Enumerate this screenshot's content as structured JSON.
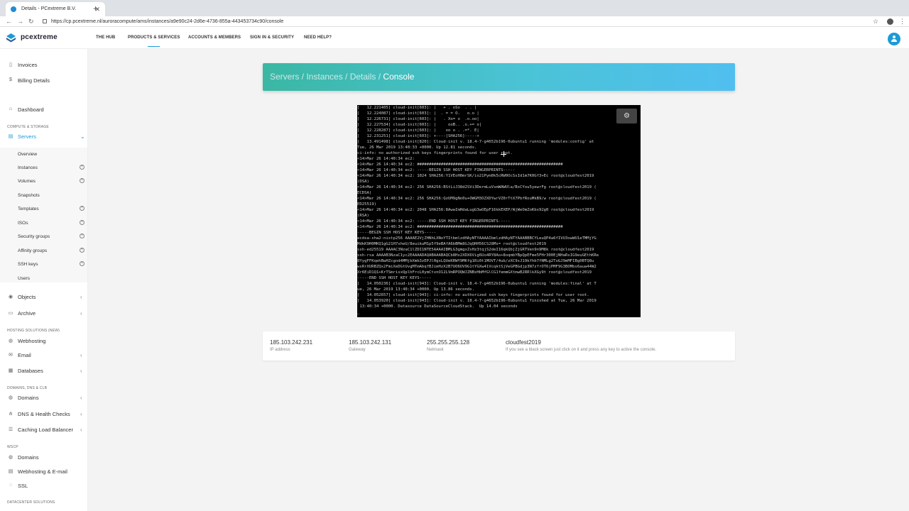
{
  "browser": {
    "tab_title": "Details - PCextreme B.V.",
    "url": "https://cp.pcextreme.nl/auroracompute/ams/instances/a9e90c24-2d6e-4736-855a-443453734c90/console"
  },
  "brand": {
    "name": "pcextreme",
    "accent": "#1d9ad6"
  },
  "topnav": [
    {
      "label": "THE HUB"
    },
    {
      "label": "PRODUCTS & SERVICES"
    },
    {
      "label": "ACCOUNTS & MEMBERS"
    },
    {
      "label": "SIGN IN & SECURITY"
    },
    {
      "label": "NEED HELP?"
    }
  ],
  "sidebar": {
    "top": [
      {
        "label": "Invoices",
        "icon": "document-icon"
      },
      {
        "label": "Billing Details",
        "icon": "dollar-icon"
      },
      {
        "label": "Dashboard",
        "icon": "home-icon"
      }
    ],
    "sections": {
      "compute": "COMPUTE & STORAGE",
      "hosting": "HOSTING SOLUTIONS (NEW)",
      "domains": "DOMAINS, DNS & CLB",
      "wscp": "WSCP",
      "datacenter": "DATACENTER SOLUTIONS"
    },
    "servers": "Servers",
    "server_subitems": [
      {
        "label": "Overview"
      },
      {
        "label": "Instances"
      },
      {
        "label": "Volumes"
      },
      {
        "label": "Snapshots"
      },
      {
        "label": "Templates"
      },
      {
        "label": "ISOs"
      },
      {
        "label": "Security groups"
      },
      {
        "label": "Affinity groups"
      },
      {
        "label": "SSH keys"
      },
      {
        "label": "Users"
      }
    ],
    "compute_more": [
      {
        "label": "Objects"
      },
      {
        "label": "Archive"
      }
    ],
    "hosting_items": [
      {
        "label": "Webhosting"
      },
      {
        "label": "Email"
      },
      {
        "label": "Databases"
      }
    ],
    "domain_items": [
      {
        "label": "Domains"
      },
      {
        "label": "DNS & Health Checks"
      },
      {
        "label": "Caching Load Balancer"
      }
    ],
    "wscp_items": [
      {
        "label": "Domains"
      },
      {
        "label": "Webhosting & E-mail"
      },
      {
        "label": "SSL"
      }
    ]
  },
  "breadcrumb": {
    "trail": "Servers / Instances / Details / ",
    "current": "Console"
  },
  "console": {
    "lines": [
      "[   12.221405] cloud-init[603]: |   + . oSo  . . |",
      "[   12.224087] cloud-init[603]: |  . = = O.   o.o |",
      "[   12.226731] cloud-init[603]: |   . Xo= o  .o.oo|",
      "[   12.227534] cloud-init[603]: |     ooB.. .o.+= o|",
      "[   12.228287] cloud-init[603]: |    oo o . .=*. E|",
      "[   12.231251] cloud-init[603]: +----[SHA256]-----+",
      "[   13.491498] cloud-init[820]: Cloud-init v. 18.4-7-g4652b196-0ubuntu1 running 'modules:config' at",
      "Tue, 26 Mar 2019 13:40:33 +0000. Up 12.81 seconds.",
      "ci-info: no authorized ssh keys fingerprints found for user root.",
      "<14>Mar 26 14:40:34 ec2:",
      "<14>Mar 26 14:40:34 ec2: #############################################################",
      "<14>Mar 26 14:40:34 ec2: -----BEGIN SSH HOST KEY FINGERPRINTS-----",
      "<14>Mar 26 14:40:34 ec2: 1024 SHA256:Y1VEoH0mrSK/io21Pym0k5cRW0OcSsId1m7K0Gf3+Ec root@cloudfest2019",
      "(DSA)",
      "<14>Mar 26 14:40:34 ec2: 256 SHA256:BStLiJ38d2SVi3DermLuVsmWAWUla/BxCYou5yewrFg root@cloudfest2019 (",
      "ECDSA)",
      "<14>Mar 26 14:40:34 ec2: 256 SHA256:QzUM9gNo0u+OWGM3OZXDYwrVZ0rTtX7PbfRouMkB9/w root@cloudfest2019 (",
      "ED25519)",
      "<14>Mar 26 14:40:34 ec2: 2048 SHA256:8AwwImHdaLugG3wOEpF16kkEXEP/WjWeOmZoKbx92g0 root@cloudfest2019",
      "(RSA)",
      "<14>Mar 26 14:40:34 ec2: -----END SSH HOST KEY FINGERPRINTS-----",
      "<14>Mar 26 14:40:34 ec2: #############################################################",
      "-----BEGIN SSH HOST KEY KEYS-----",
      "ecdsa-sha2-nistp256 AAAAE2VjZHNhLXNoYTItbmlzdHAyNTYAAAAIbmlzdHAyNTYAAABBBCYLeuQP4a6fIVU3owWU1eTMMjYG",
      "MdkK9H0MKQ1gG21H7xheU/8euikuM1p5f9eBAfA6bBMm8GJqQHH56CS28Ms= root@cloudfest2019",
      "ssh-ed25519 AAAAC3NzaC1lZDI1NTE5AAAAIBMLG3gmgxZsHz3tqjS2deI16qkQbjZjGRTVen9n9M8k root@cloudfest2019",
      "ssh-rsa AAAAB3NzaC1yc2EAAAADAQABAAABAQCb8Hx2XDX6Vig6Uo4RY8Ao+8oqmbYBpQpEFme5FHr300EjNHaRsIG9euGEthKRe",
      "8YygFFKqehBwHZcgnd4MMjbXmb3zEPJlHgxLQUeKRWY9MKfg1Ri0t1MOVT/4ub/zXC9sJ19kfhb7fNMLg2ToGJ9mMFIBg0BTQ8u",
      "wsRrXURBZQx2FmiXeDGtUvgMTmAbqfBJimHzX2B7UO6UV9G1tYGXw41VcqktSjVeGPBGdjp3N7zfrOT6jPMF9G3BOMbs6aua44W2",
      "Xr6EiD1Q1+KrTSmrisxQplhFrcL0ymCtvnO12LVmRPOQWJZNBxHbMfGlCG1femmGXtmwB2RRlkXGy9t root@cloudfest2019",
      "-----END SSH HOST KEY KEYS-----",
      "[   14.050236] cloud-init[943]: Cloud-init v. 18.4-7-g4652b196-0ubuntu1 running 'modules:final' at T",
      "ue, 26 Mar 2019 13:40:34 +0000. Up 13.86 seconds.",
      "[   14.052657] cloud-init[943]: ci-info: no authorized ssh keys fingerprints found for user root.",
      "[   14.053920] cloud-init[943]: Cloud-init v. 18.4-7-g4652b196-0ubuntu1 finished at Tue, 26 Mar 2019",
      " 13:40:34 +0000. Datasource DataSourceCloudStack.  Up 14.04 seconds",
      "_"
    ]
  },
  "info": {
    "ip": {
      "value": "185.103.242.231",
      "label": "IP address"
    },
    "gateway": {
      "value": "185.103.242.131",
      "label": "Gateway"
    },
    "netmask": {
      "value": "255.255.255.128",
      "label": "Netmask"
    },
    "host": {
      "value": "cloudfest2019",
      "label": "If you see a black screen just click on it and press any key to active the console."
    }
  }
}
